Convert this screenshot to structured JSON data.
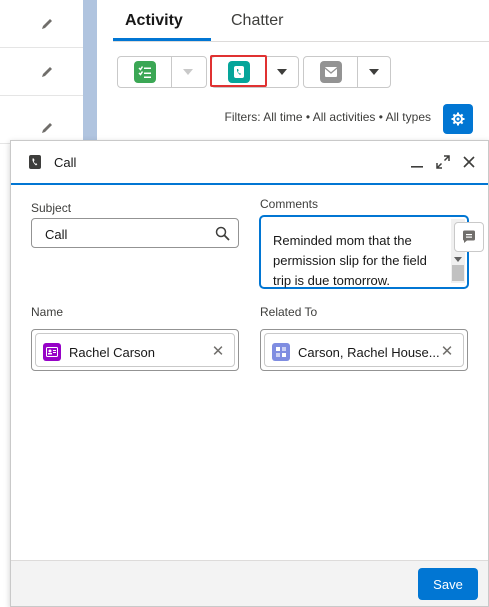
{
  "activity": {
    "tabs": [
      {
        "label": "Activity",
        "active": true
      },
      {
        "label": "Chatter",
        "active": false
      }
    ],
    "actions": [
      {
        "icon": "task-icon",
        "color": "#3ba755"
      },
      {
        "icon": "call-icon",
        "color": "#06a59a"
      },
      {
        "icon": "email-icon",
        "color": "#939393"
      }
    ],
    "filters": "Filters: All time • All activities • All types"
  },
  "modal": {
    "title": "Call",
    "subject": {
      "label": "Subject",
      "value": "Call"
    },
    "comments": {
      "label": "Comments",
      "value": "Reminded mom that the permission slip for the field trip is due tomorrow."
    },
    "name": {
      "label": "Name",
      "value": "Rachel Carson",
      "icon_color": "#9602c7"
    },
    "related": {
      "label": "Related To",
      "value": "Carson, Rachel House...",
      "icon_color": "#7f8de1"
    },
    "save_label": "Save"
  },
  "colors": {
    "brand": "#0176d3",
    "highlight": "#e03131"
  }
}
